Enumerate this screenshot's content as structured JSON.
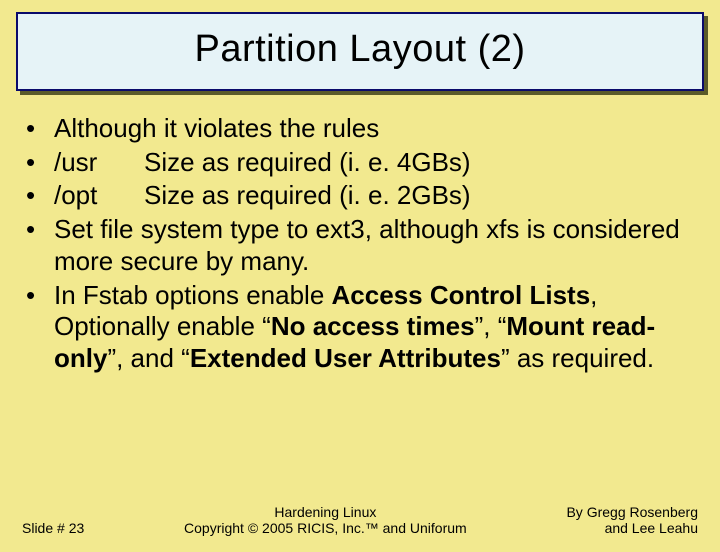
{
  "title": "Partition Layout (2)",
  "bullets": {
    "b0": "Although it violates the rules",
    "b1_dir": "/usr",
    "b1_desc": "Size as required (i. e. 4GBs)",
    "b2_dir": "/opt",
    "b2_desc": "Size as required (i. e. 2GBs)",
    "b3": "Set file system type to ext3, although xfs is considered more secure by many.",
    "b4_pre": "In Fstab options enable ",
    "b4_s1": "Access Control Lists",
    "b4_mid1": ", Optionally enable “",
    "b4_s2": "No access times",
    "b4_mid2": "”, “",
    "b4_s3": "Mount read-only",
    "b4_mid3": "”, and “",
    "b4_s4": "Extended User Attributes",
    "b4_tail": "” as required."
  },
  "footer": {
    "slide": "Slide # 23",
    "center_line1": "Hardening Linux",
    "center_line2": "Copyright © 2005 RICIS, Inc.™ and Uniforum",
    "right_line1": "By Gregg Rosenberg",
    "right_line2": "and Lee Leahu"
  }
}
